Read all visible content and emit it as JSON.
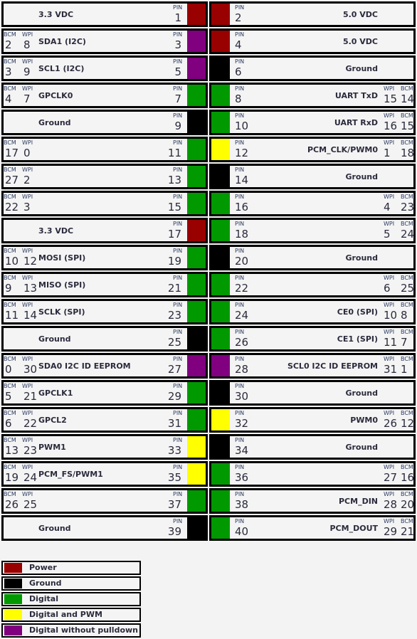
{
  "labels": {
    "pin": "PIN",
    "bcm": "BCM",
    "wpi": "WPI"
  },
  "colors": {
    "power": "#990000",
    "ground": "#000000",
    "digital": "#009900",
    "pwm": "#ffff00",
    "nopull": "#800080"
  },
  "rows": [
    {
      "left": {
        "pin": "1",
        "name": "3.3 VDC",
        "type": "power"
      },
      "right": {
        "pin": "2",
        "name": "5.0 VDC",
        "type": "power"
      }
    },
    {
      "left": {
        "pin": "3",
        "name": "SDA1 (I2C)",
        "bcm": "2",
        "wpi": "8",
        "type": "nopull"
      },
      "right": {
        "pin": "4",
        "name": "5.0 VDC",
        "type": "power"
      }
    },
    {
      "left": {
        "pin": "5",
        "name": "SCL1 (I2C)",
        "bcm": "3",
        "wpi": "9",
        "type": "nopull"
      },
      "right": {
        "pin": "6",
        "name": "Ground",
        "type": "ground"
      }
    },
    {
      "left": {
        "pin": "7",
        "name": "GPCLK0",
        "bcm": "4",
        "wpi": "7",
        "type": "digital"
      },
      "right": {
        "pin": "8",
        "name": "UART TxD",
        "wpi": "15",
        "bcm": "14",
        "type": "digital"
      }
    },
    {
      "left": {
        "pin": "9",
        "name": "Ground",
        "type": "ground"
      },
      "right": {
        "pin": "10",
        "name": "UART RxD",
        "wpi": "16",
        "bcm": "15",
        "type": "digital"
      }
    },
    {
      "left": {
        "pin": "11",
        "name": "",
        "bcm": "17",
        "wpi": "0",
        "type": "digital"
      },
      "right": {
        "pin": "12",
        "name": "PCM_CLK/PWM0",
        "wpi": "1",
        "bcm": "18",
        "type": "pwm"
      }
    },
    {
      "left": {
        "pin": "13",
        "name": "",
        "bcm": "27",
        "wpi": "2",
        "type": "digital"
      },
      "right": {
        "pin": "14",
        "name": "Ground",
        "type": "ground"
      }
    },
    {
      "left": {
        "pin": "15",
        "name": "",
        "bcm": "22",
        "wpi": "3",
        "type": "digital"
      },
      "right": {
        "pin": "16",
        "name": "",
        "wpi": "4",
        "bcm": "23",
        "type": "digital"
      }
    },
    {
      "left": {
        "pin": "17",
        "name": "3.3 VDC",
        "type": "power"
      },
      "right": {
        "pin": "18",
        "name": "",
        "wpi": "5",
        "bcm": "24",
        "type": "digital"
      }
    },
    {
      "left": {
        "pin": "19",
        "name": "MOSI (SPI)",
        "bcm": "10",
        "wpi": "12",
        "type": "digital"
      },
      "right": {
        "pin": "20",
        "name": "Ground",
        "type": "ground"
      }
    },
    {
      "left": {
        "pin": "21",
        "name": "MISO (SPI)",
        "bcm": "9",
        "wpi": "13",
        "type": "digital"
      },
      "right": {
        "pin": "22",
        "name": "",
        "wpi": "6",
        "bcm": "25",
        "type": "digital"
      }
    },
    {
      "left": {
        "pin": "23",
        "name": "SCLK (SPI)",
        "bcm": "11",
        "wpi": "14",
        "type": "digital"
      },
      "right": {
        "pin": "24",
        "name": "CE0 (SPI)",
        "wpi": "10",
        "bcm": "8",
        "type": "digital"
      }
    },
    {
      "left": {
        "pin": "25",
        "name": "Ground",
        "type": "ground"
      },
      "right": {
        "pin": "26",
        "name": "CE1 (SPI)",
        "wpi": "11",
        "bcm": "7",
        "type": "digital"
      }
    },
    {
      "left": {
        "pin": "27",
        "name": "SDA0 I2C ID EEPROM",
        "bcm": "0",
        "wpi": "30",
        "type": "nopull"
      },
      "right": {
        "pin": "28",
        "name": "SCL0 I2C ID EEPROM",
        "wpi": "31",
        "bcm": "1",
        "type": "nopull"
      }
    },
    {
      "left": {
        "pin": "29",
        "name": "GPCLK1",
        "bcm": "5",
        "wpi": "21",
        "type": "digital"
      },
      "right": {
        "pin": "30",
        "name": "Ground",
        "type": "ground"
      }
    },
    {
      "left": {
        "pin": "31",
        "name": "GPCL2",
        "bcm": "6",
        "wpi": "22",
        "type": "digital"
      },
      "right": {
        "pin": "32",
        "name": "PWM0",
        "wpi": "26",
        "bcm": "12",
        "type": "pwm"
      }
    },
    {
      "left": {
        "pin": "33",
        "name": "PWM1",
        "bcm": "13",
        "wpi": "23",
        "type": "pwm"
      },
      "right": {
        "pin": "34",
        "name": "Ground",
        "type": "ground"
      }
    },
    {
      "left": {
        "pin": "35",
        "name": "PCM_FS/PWM1",
        "bcm": "19",
        "wpi": "24",
        "type": "pwm"
      },
      "right": {
        "pin": "36",
        "name": "",
        "wpi": "27",
        "bcm": "16",
        "type": "digital"
      }
    },
    {
      "left": {
        "pin": "37",
        "name": "",
        "bcm": "26",
        "wpi": "25",
        "type": "digital"
      },
      "right": {
        "pin": "38",
        "name": "PCM_DIN",
        "wpi": "28",
        "bcm": "20",
        "type": "digital"
      }
    },
    {
      "left": {
        "pin": "39",
        "name": "Ground",
        "type": "ground"
      },
      "right": {
        "pin": "40",
        "name": "PCM_DOUT",
        "wpi": "29",
        "bcm": "21",
        "type": "digital"
      }
    }
  ],
  "legend": [
    {
      "label": "Power",
      "type": "power"
    },
    {
      "label": "Ground",
      "type": "ground"
    },
    {
      "label": "Digital",
      "type": "digital"
    },
    {
      "label": "Digital and PWM",
      "type": "pwm"
    },
    {
      "label": "Digital without pulldown",
      "type": "nopull"
    }
  ]
}
